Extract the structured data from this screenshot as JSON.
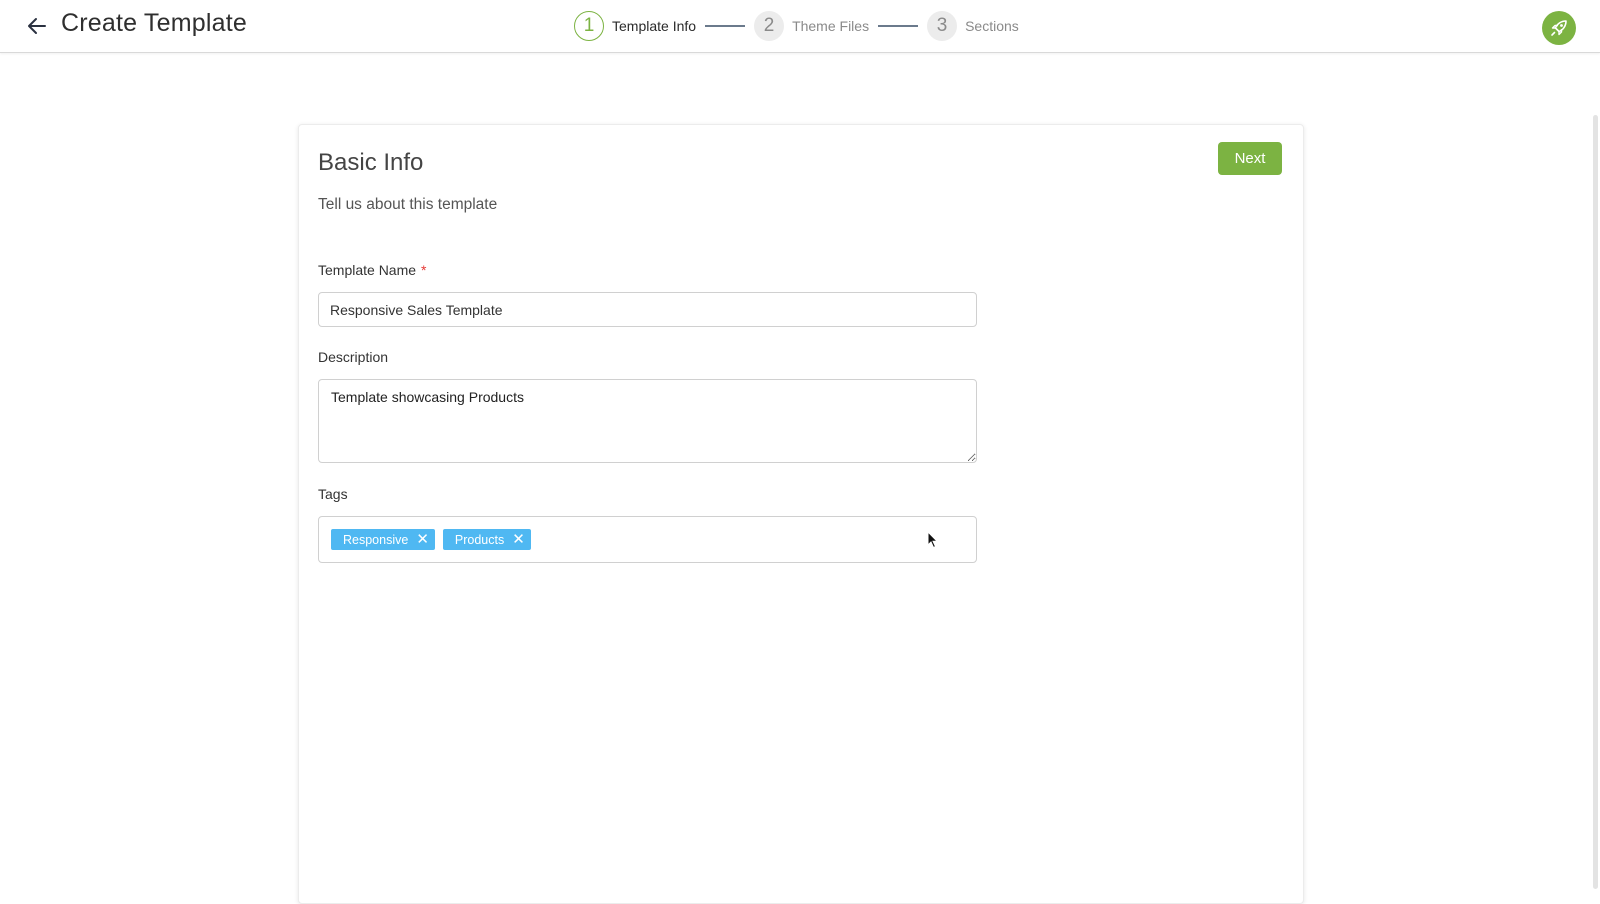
{
  "header": {
    "title": "Create Template",
    "steps": [
      {
        "number": "1",
        "label": "Template Info",
        "state": "active"
      },
      {
        "number": "2",
        "label": "Theme Files",
        "state": "inactive"
      },
      {
        "number": "3",
        "label": "Sections",
        "state": "inactive"
      }
    ],
    "back_icon": "arrow-left-icon",
    "avatar_icon": "rocket-icon"
  },
  "form": {
    "title": "Basic Info",
    "subtitle": "Tell us about this template",
    "next_label": "Next",
    "template_name": {
      "label": "Template Name",
      "required_mark": "*",
      "value": "Responsive Sales Template"
    },
    "description": {
      "label": "Description",
      "value": "Template showcasing Products"
    },
    "tags": {
      "label": "Tags",
      "items": [
        "Responsive",
        "Products"
      ],
      "remove_glyph": "✕"
    }
  },
  "colors": {
    "accent": "#7cb342",
    "tag": "#4fb8f2",
    "required": "#e53935"
  }
}
